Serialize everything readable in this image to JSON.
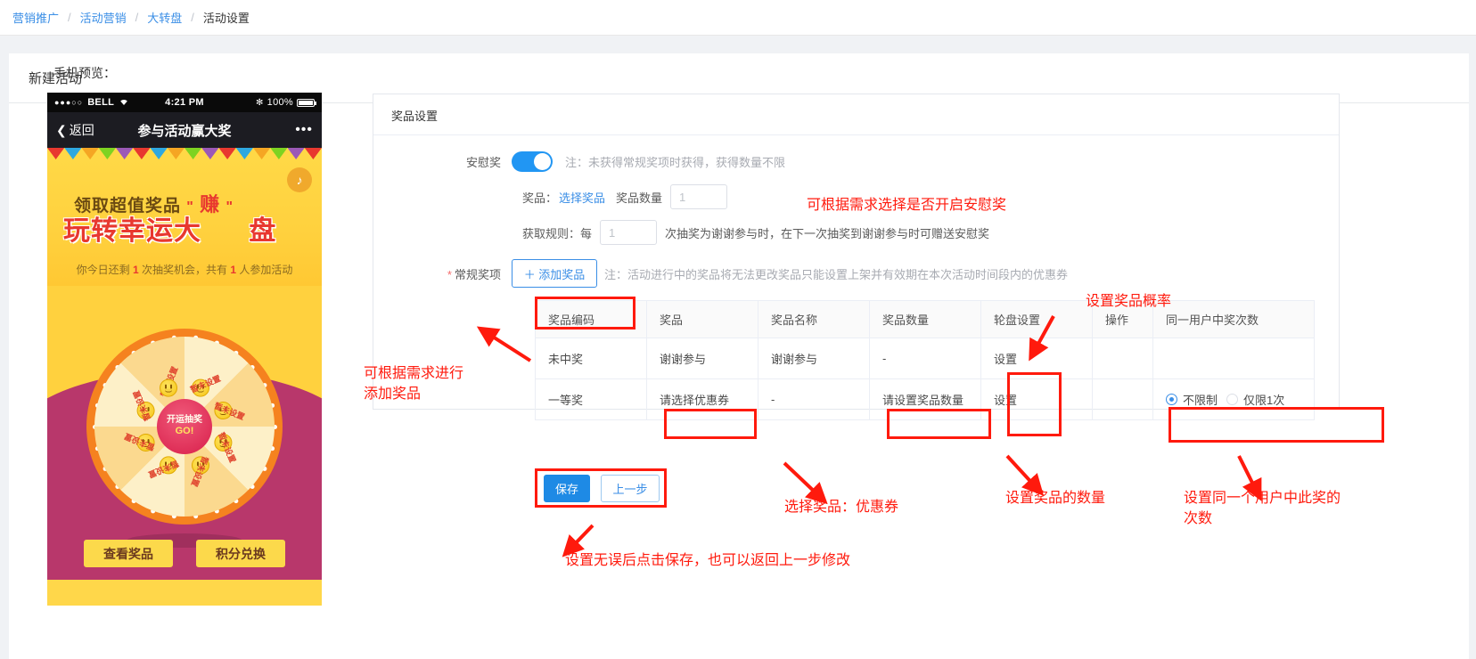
{
  "breadcrumb": {
    "items": [
      {
        "label": "营销推广",
        "type": "link"
      },
      {
        "label": "活动营销",
        "type": "link"
      },
      {
        "label": "大转盘",
        "type": "link"
      },
      {
        "label": "活动设置",
        "type": "current"
      }
    ],
    "separator": "/"
  },
  "card": {
    "title": "新建活动"
  },
  "preview": {
    "label": "手机预览：",
    "status_bar": {
      "dots": "●●●○○",
      "carrier": "BELL",
      "wifi": "wifi-icon",
      "time": "4:21 PM",
      "bluetooth": "bluetooth-icon",
      "battery": "100%"
    },
    "nav": {
      "back": "返回",
      "title": "参与活动赢大奖",
      "more": "•••"
    },
    "banner": {
      "line1": "领取超值奖品",
      "quote_open": "\"",
      "quote_close": "\"",
      "word_zhuan": "赚",
      "line2_a": "玩转幸运大",
      "line2_b": "盘",
      "sub_1": "你今日还剩 ",
      "sub_n1": "1",
      "sub_2": " 次抽奖机会，共有 ",
      "sub_n2": "1",
      "sub_3": " 人参加活动",
      "music_icon": "music-note-icon"
    },
    "wheel": {
      "segment_label": "暂未设置",
      "segments": [
        "暂未设置",
        "暂未设置",
        "暂未设置",
        "暂未设置",
        "暂未设置",
        "暂未设置",
        "暂未设置",
        "暂未设置"
      ],
      "center_top": "开运抽奖",
      "center_bottom": "GO!"
    },
    "bottom_buttons": [
      {
        "label": "查看奖品"
      },
      {
        "label": "积分兑换"
      }
    ]
  },
  "panel": {
    "title": "奖品设置",
    "consolation": {
      "label": "安慰奖",
      "switch_on": true,
      "note": "注：未获得常规奖项时获得，获得数量不限",
      "prize_label": "奖品：",
      "prize_link": "选择奖品",
      "qty_label": "奖品数量",
      "qty_value": "1",
      "rule_prefix": "获取规则：每",
      "rule_value": "1",
      "rule_suffix": "次抽奖为谢谢参与时，在下一次抽奖到谢谢参与时可赠送安慰奖"
    },
    "regular": {
      "label": "常规奖项",
      "required": "*",
      "add_button": "＋ 添加奖品",
      "note": "注：活动进行中的奖品将无法更改奖品只能设置上架并有效期在本次活动时间段内的优惠券"
    },
    "table": {
      "headers": [
        "奖品编码",
        "奖品",
        "奖品名称",
        "奖品数量",
        "轮盘设置",
        "操作",
        "同一用户中奖次数"
      ],
      "rows": [
        {
          "code": "未中奖",
          "prize": "谢谢参与",
          "prize_name": "谢谢参与",
          "qty": "-",
          "wheel_setting": "设置",
          "action": "",
          "limit_options": []
        },
        {
          "code": "一等奖",
          "prize": "请选择优惠券",
          "prize_name": "-",
          "qty": "请设置奖品数量",
          "wheel_setting": "设置",
          "action": "",
          "limit_options": [
            {
              "label": "不限制",
              "selected": true
            },
            {
              "label": "仅限1次",
              "selected": false
            }
          ]
        }
      ]
    }
  },
  "footer": {
    "save": "保存",
    "prev": "上一步"
  },
  "annotations": [
    {
      "id": "a1",
      "text": "可根据需求选择是否开启安慰奖"
    },
    {
      "id": "a2",
      "text": "设置奖品概率"
    },
    {
      "id": "a3",
      "text": "可根据需求进行\n添加奖品"
    },
    {
      "id": "a4",
      "text": "选择奖品：优惠券"
    },
    {
      "id": "a5",
      "text": "设置奖品的数量"
    },
    {
      "id": "a6",
      "text": "设置同一个用户中此奖的\n次数"
    },
    {
      "id": "a7",
      "text": "设置无误后点击保存，也可以返回上一步修改"
    }
  ],
  "colors": {
    "accent_blue": "#3a8ee6",
    "annotation_red": "#ff1a0d",
    "switch_on": "#2196f3",
    "banner_yellow": "#ffd13e",
    "wheel_orange": "#f5821f"
  }
}
